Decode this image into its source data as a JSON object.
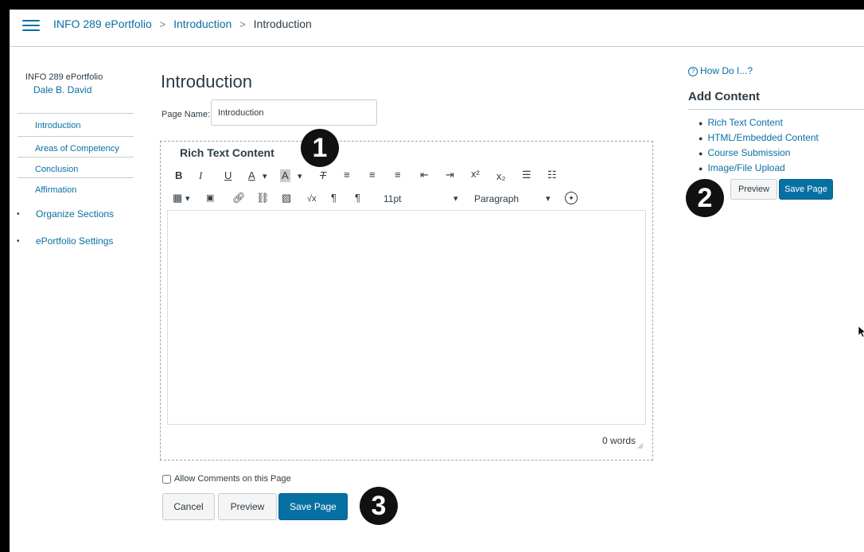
{
  "header": {
    "breadcrumbs": [
      "INFO 289 ePortfolio",
      "Introduction",
      "Introduction"
    ]
  },
  "nav": {
    "course": "INFO 289 ePortfolio",
    "user": "Dale B. David",
    "sections": [
      "Introduction",
      "Areas of Competency",
      "Conclusion",
      "Affirmation"
    ],
    "organize": "Organize Sections",
    "settings": "ePortfolio Settings"
  },
  "main": {
    "title": "Introduction",
    "page_name_label": "Page Name:",
    "page_name_value": "Introduction",
    "editor": {
      "section_title": "Rich Text Content",
      "font_size": "11pt",
      "block_format": "Paragraph",
      "word_count": "0 words"
    },
    "allow_comments_label": "Allow Comments on this Page",
    "buttons": {
      "cancel": "Cancel",
      "preview": "Preview",
      "save": "Save Page"
    }
  },
  "sidebar": {
    "how_do_i": "How Do I...?",
    "add_content_title": "Add Content",
    "add_content_items": [
      "Rich Text Content",
      "HTML/Embedded Content",
      "Course Submission",
      "Image/File Upload"
    ],
    "buttons": {
      "preview": "Preview",
      "save": "Save Page"
    }
  },
  "callouts": [
    "1",
    "2",
    "3"
  ],
  "colors": {
    "link": "#0770a3",
    "primary_button": "#0770a3",
    "text": "#2d3b45",
    "border": "#c7cdd1"
  }
}
